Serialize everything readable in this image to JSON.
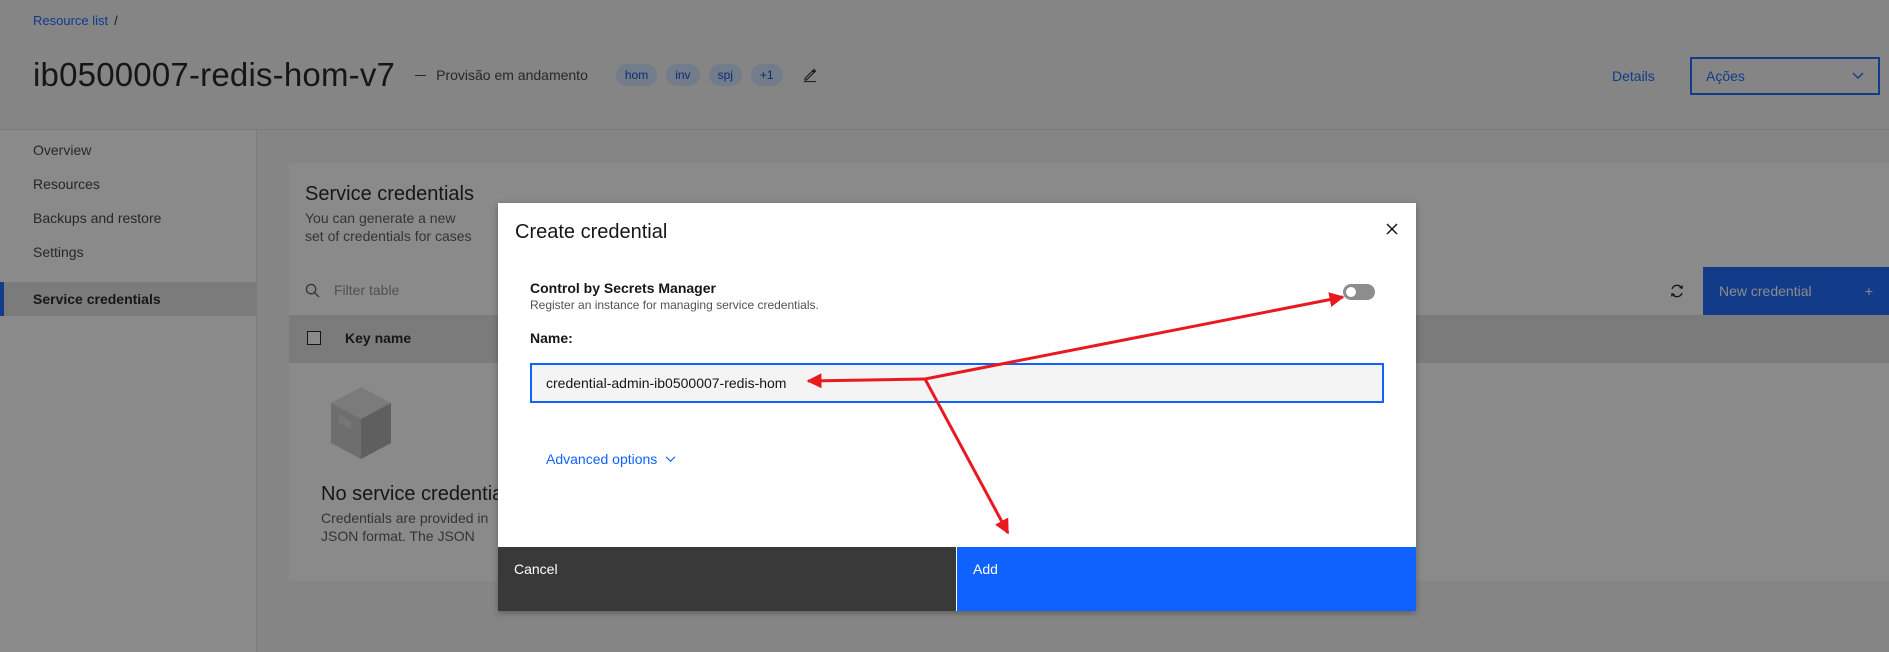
{
  "breadcrumb": {
    "link": "Resource list",
    "separator": "/"
  },
  "header": {
    "title": "ib0500007-redis-hom-v7",
    "status": "Provisão em andamento",
    "tags": [
      "hom",
      "inv",
      "spj",
      "+1"
    ],
    "details_label": "Details",
    "actions_label": "Ações"
  },
  "sidebar": {
    "items": [
      {
        "label": "Overview",
        "active": false
      },
      {
        "label": "Resources",
        "active": false
      },
      {
        "label": "Backups and restore",
        "active": false
      },
      {
        "label": "Settings",
        "active": false
      },
      {
        "label": "Service credentials",
        "active": true
      }
    ]
  },
  "main": {
    "title": "Service credentials",
    "description": "You can generate a new set of credentials for cases where you want to connect an external consumer to an IBM C",
    "filter_placeholder": "Filter table",
    "new_credential_label": "New credential",
    "new_credential_icon": "+",
    "table_header": "Key name",
    "empty_title": "No service credentials",
    "empty_description": "Credentials are provided in JSON format. The JSON snippet lists credentials, such as the API key and secret, as well as connection information"
  },
  "modal": {
    "title": "Create credential",
    "secrets_manager_label": "Control by Secrets Manager",
    "secrets_manager_helper": "Register an instance for managing service credentials.",
    "secrets_manager_enabled": false,
    "name_label": "Name:",
    "name_value": "credential-admin-ib0500007-redis-hom",
    "advanced_label": "Advanced options",
    "cancel_label": "Cancel",
    "add_label": "Add"
  },
  "colors": {
    "primary": "#0f62fe",
    "annotation": "#e8191f",
    "tag_bg": "#d0e2ff"
  },
  "annotations": {
    "arrow_color": "#e8191f"
  }
}
